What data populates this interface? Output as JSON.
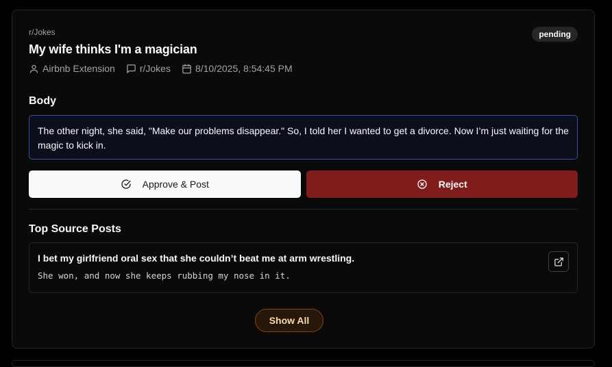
{
  "post": {
    "subreddit": "r/Jokes",
    "status": "pending",
    "title": "My wife thinks I'm a magician",
    "meta": {
      "author": "Airbnb Extension",
      "community": "r/Jokes",
      "date": "8/10/2025, 8:54:45 PM"
    },
    "body_label": "Body",
    "body": "The other night, she said, \"Make our problems disappear.\" So, I told her I wanted to get a divorce. Now I’m just waiting for the magic to kick in."
  },
  "actions": {
    "approve_label": "Approve & Post",
    "reject_label": "Reject"
  },
  "sources": {
    "label": "Top Source Posts",
    "items": [
      {
        "title": "I bet my girlfriend oral sex that she couldn’t beat me at arm wrestling.",
        "text": "She won, and now she keeps rubbing my nose in it."
      }
    ],
    "show_all_label": "Show All"
  },
  "icons": {
    "author": "user-icon",
    "community": "message-square-icon",
    "date": "calendar-icon",
    "approve": "check-circle-icon",
    "reject": "x-circle-icon",
    "external": "external-link-icon"
  },
  "colors": {
    "reject_bg": "#7f1d1d",
    "body_border": "#3b4fa8",
    "show_all_border": "#92400e"
  }
}
